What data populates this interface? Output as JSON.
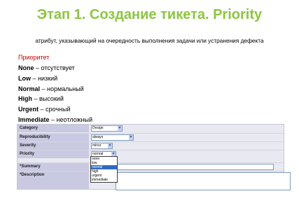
{
  "slide": {
    "title": "Этап 1. Создание тикета. Priority",
    "subtitle": "атрибут, указывающий на очередность выполнения задачи или устранения дефекта",
    "section_heading": "Приоритет",
    "levels": [
      {
        "name": "None",
        "desc": " – отсутствует"
      },
      {
        "name": "Low",
        "desc": " – низкий"
      },
      {
        "name": "Normal",
        "desc": " – нормальный"
      },
      {
        "name": "High",
        "desc": " – высокий"
      },
      {
        "name": "Urgent",
        "desc": " – срочный"
      },
      {
        "name": "Immediate",
        "desc": " – неотложный"
      }
    ]
  },
  "form": {
    "category": {
      "label": "Category",
      "value": "Design"
    },
    "reproducibility": {
      "label": "Reproducibility",
      "value": "always"
    },
    "severity": {
      "label": "Severity",
      "value": "minor"
    },
    "priority": {
      "label": "Priority",
      "value": "normal",
      "options": [
        "none",
        "low",
        "normal",
        "high",
        "urgent",
        "immediate"
      ],
      "highlighted": "normal"
    },
    "summary": {
      "label": "*Summary"
    },
    "description": {
      "label": "*Description"
    }
  },
  "colors": {
    "title": "#8dc63f",
    "section_heading": "#c00000",
    "label_bg": "#c9c9e1",
    "highlight": "#316ac5"
  }
}
